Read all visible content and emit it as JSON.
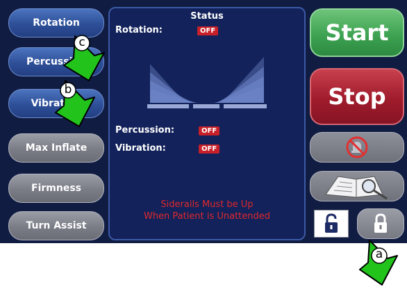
{
  "left_menu": {
    "rotation": "Rotation",
    "percussion": "Percussion",
    "vibration": "Vibration",
    "max_inflate": "Max Inflate",
    "firmness": "Firmness",
    "turn_assist": "Turn Assist"
  },
  "status_panel": {
    "title": "Status",
    "rotation_label": "Rotation:",
    "rotation_state": "OFF",
    "percussion_label": "Percussion:",
    "percussion_state": "OFF",
    "vibration_label": "Vibration:",
    "vibration_state": "OFF",
    "warning_line1": "Siderails Must be Up",
    "warning_line2": "When Patient is Unattended"
  },
  "right_controls": {
    "start": "Start",
    "stop": "Stop",
    "alarm_silence_icon": "alarm-silenced-icon",
    "manual_icon": "manual-search-icon",
    "unlock_icon": "unlock-icon",
    "lock_icon": "lock-icon"
  },
  "callouts": {
    "a": "a",
    "b": "b",
    "c": "c"
  },
  "colors": {
    "panel": "#13225a",
    "start": "#3ea352",
    "stop": "#a01c2c",
    "off_badge": "#c8202a",
    "warning": "#e0282c",
    "callout_green": "#22c41c"
  }
}
